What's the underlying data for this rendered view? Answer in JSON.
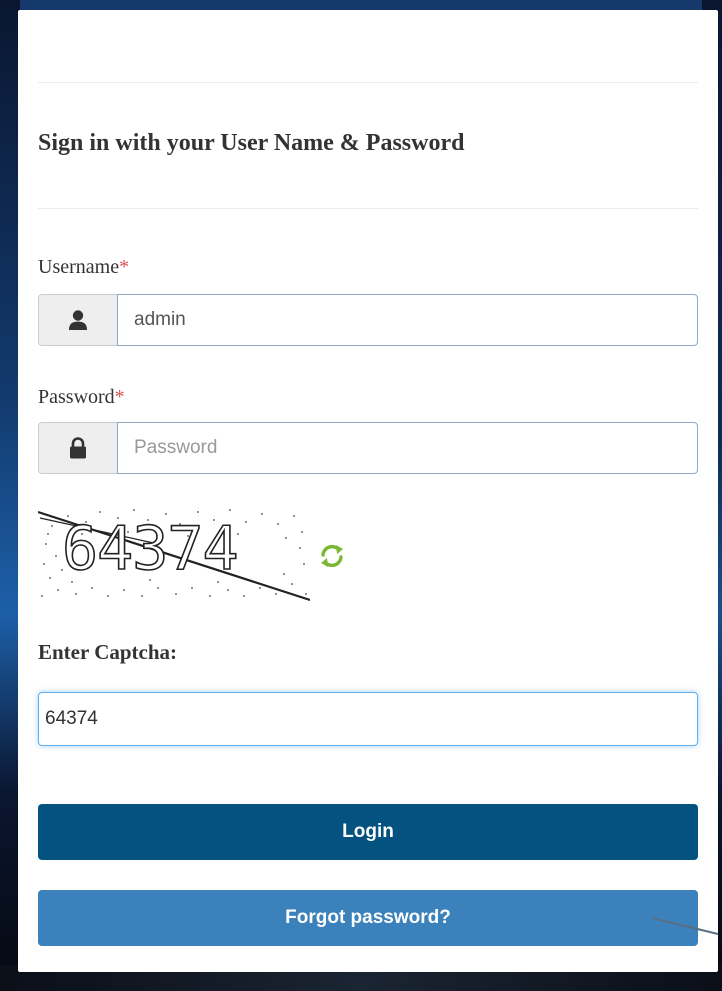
{
  "form": {
    "heading": "Sign in with your User Name & Password",
    "username": {
      "label": "Username",
      "required_mark": "*",
      "value": "admin",
      "icon": "user-icon"
    },
    "password": {
      "label": "Password",
      "required_mark": "*",
      "value": "",
      "placeholder": "Password",
      "icon": "lock-icon"
    },
    "captcha": {
      "image_text": "64374",
      "refresh_icon": "refresh-icon",
      "label": "Enter Captcha:",
      "value": "64374"
    },
    "login_label": "Login",
    "forgot_label": "Forgot password?"
  },
  "colors": {
    "login_button": "#03527f",
    "forgot_button": "#3b81bb",
    "required": "#d9534f",
    "refresh_icon": "#7ab834",
    "focus_border": "#66afe9"
  }
}
